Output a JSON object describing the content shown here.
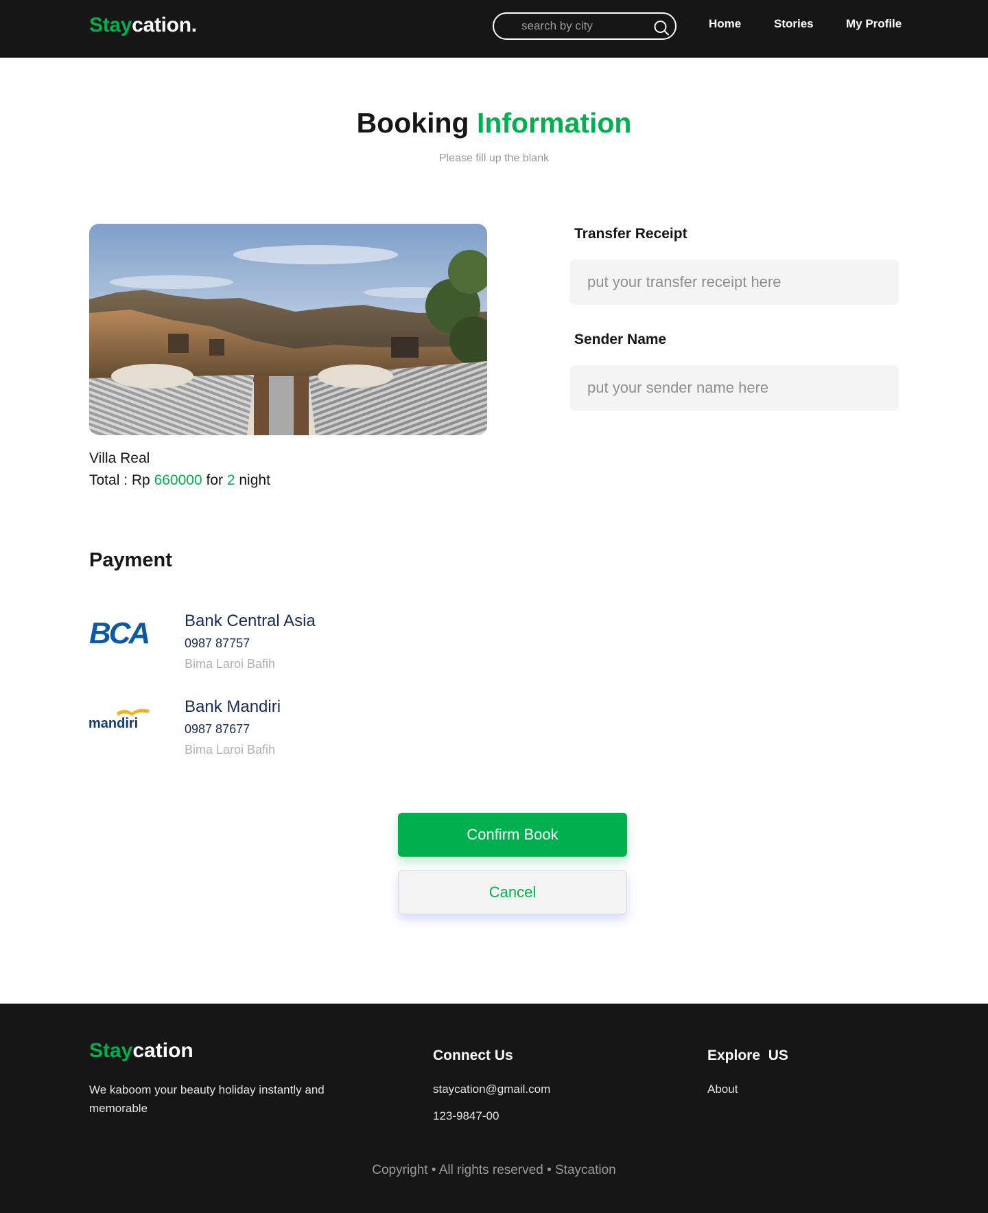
{
  "navbar": {
    "logo_accent": "Stay",
    "logo_rest": "cation.",
    "search_placeholder": "search by city",
    "links": [
      {
        "label": "Home"
      },
      {
        "label": "Stories"
      },
      {
        "label": "My Profile"
      }
    ]
  },
  "heading": {
    "title_main": "Booking",
    "title_accent": "Information",
    "subtitle": "Please fill up the blank"
  },
  "property": {
    "name": "Villa Real",
    "total_prefix": "Total : Rp",
    "total_amount": "660000",
    "for_text": "for",
    "nights": "2",
    "night_label": "night"
  },
  "form": {
    "receipt_label": "Transfer Receipt",
    "receipt_placeholder": "put your transfer receipt here",
    "sender_label": "Sender Name",
    "sender_placeholder": "put your sender name here"
  },
  "payment": {
    "title": "Payment",
    "banks": [
      {
        "logo_text": "BCA",
        "name": "Bank Central Asia",
        "number": "0987 87757",
        "holder": "Bima Laroi Bafih"
      },
      {
        "logo_text": "mandiri",
        "name": "Bank Mandiri",
        "number": "0987 87677",
        "holder": "Bima Laroi Bafih"
      }
    ]
  },
  "buttons": {
    "confirm": "Confirm Book",
    "cancel": "Cancel"
  },
  "footer": {
    "logo_accent": "Stay",
    "logo_rest": "cation",
    "tagline": "We kaboom your beauty holiday instantly and memorable",
    "connect_heading": "Connect Us",
    "email": "staycation@gmail.com",
    "phone": "123-9847-00",
    "explore_heading": "Explore  US",
    "about": "About",
    "copyright": "Copyright • All rights reserved • Staycation"
  },
  "colors": {
    "accent": "#00b04e",
    "navy": "#152c5b",
    "dark": "#161616"
  },
  "icons": {
    "search": "search-icon"
  }
}
